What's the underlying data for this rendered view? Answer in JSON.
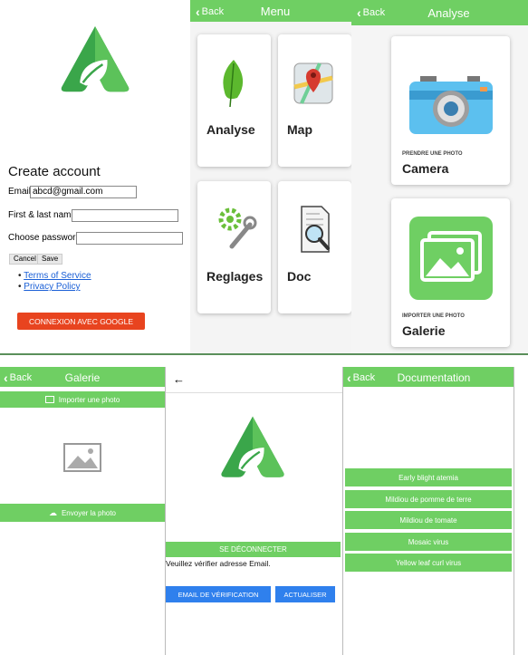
{
  "colors": {
    "accent": "#6fcf63",
    "google_button": "#e8441f",
    "verify_button": "#2f80ed",
    "logo_green": "#3aa64a"
  },
  "signup": {
    "title": "Create account",
    "email_label": "Email",
    "email_value": "abcd@gmail.com",
    "name_label": "First & last name",
    "password_label": "Choose password",
    "cancel_label": "Cancel",
    "save_label": "Save",
    "links": [
      "Terms of Service",
      "Privacy Policy"
    ],
    "google_button": "CONNEXION AVEC GOOGLE"
  },
  "menu": {
    "back": "Back",
    "title": "Menu",
    "tiles": [
      {
        "label": "Analyse",
        "icon": "leaf-icon"
      },
      {
        "label": "Map",
        "icon": "map-pin-icon"
      },
      {
        "label": "Reglages",
        "icon": "settings-wrench-icon"
      },
      {
        "label": "Doc",
        "icon": "document-magnifier-icon"
      }
    ]
  },
  "analyse": {
    "back": "Back",
    "title": "Analyse",
    "cards": [
      {
        "caption": "PRENDRE UNE PHOTO",
        "label": "Camera",
        "icon": "camera-icon"
      },
      {
        "caption": "IMPORTER UNE PHOTO",
        "label": "Galerie",
        "icon": "gallery-icon"
      }
    ]
  },
  "galerie": {
    "back": "Back",
    "title": "Galerie",
    "import_label": "Importer une photo",
    "send_label": "Envoyer la photo"
  },
  "verify": {
    "disconnect": "SE DÉCONNECTER",
    "message": "Veuillez vérifier adresse Email.",
    "verify_button": "EMAIL DE VÉRIFICATION",
    "refresh_button": "ACTUALISER"
  },
  "documentation": {
    "back": "Back",
    "title": "Documentation",
    "items": [
      "Early blight atemia",
      "Mildiou de pomme de terre",
      "Mildiou de tomate",
      "Mosaic virus",
      "Yellow leaf curl virus"
    ]
  }
}
